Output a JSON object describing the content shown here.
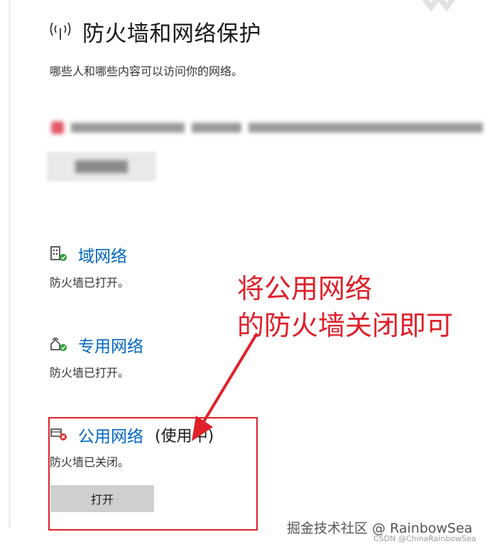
{
  "header": {
    "icon": "antenna-icon",
    "title": "防火墙和网络保护",
    "subtitle": "哪些人和哪些内容可以访问你的网络。"
  },
  "networks": [
    {
      "icon": "domain-network-icon",
      "name": "域网络",
      "status": "防火墙已打开。",
      "status_color": "#2e9e3a"
    },
    {
      "icon": "private-network-icon",
      "name": "专用网络",
      "status": "防火墙已打开。",
      "status_color": "#2e9e3a"
    },
    {
      "icon": "public-network-icon",
      "name": "公用网络",
      "in_use": "(使用中)",
      "status": "防火墙已关闭。",
      "status_color": "#d9342b",
      "button_label": "打开"
    }
  ],
  "annotation": {
    "line1": "将公用网络",
    "line2": "的防火墙关闭即可",
    "color": "#e0202a"
  },
  "watermark": {
    "main": "掘金技术社区 @ RainbowSea",
    "sub": "CSDN @ChinaRainbowSea"
  },
  "colors": {
    "link": "#0067c0",
    "button_bg": "#cfcfcf"
  }
}
